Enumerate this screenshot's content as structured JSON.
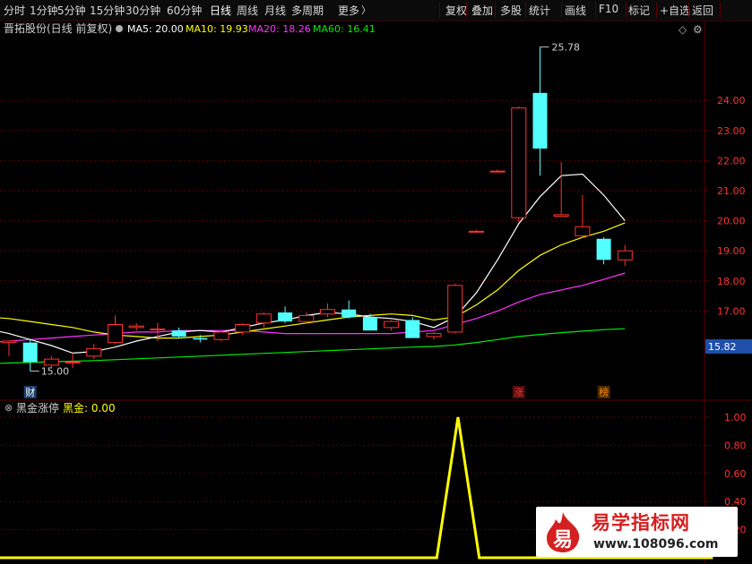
{
  "toolbar": {
    "periods": [
      "分时",
      "1分钟",
      "5分钟",
      "15分钟",
      "30分钟",
      "60分钟",
      "日线",
      "周线",
      "月线",
      "多周期"
    ],
    "active": "日线",
    "more": "更多",
    "more_arrow": "〉",
    "actions": [
      "复权",
      "叠加",
      "多股",
      "统计",
      "画线",
      "F10",
      "标记",
      "+自选",
      "返回"
    ]
  },
  "main_panel": {
    "title": "晋拓股份(日线 前复权)",
    "ma_legend": [
      {
        "label": "MA5: 20.00",
        "color": "#ffffff"
      },
      {
        "label": "MA10: 19.93",
        "color": "#ffff00"
      },
      {
        "label": "MA20: 18.26",
        "color": "#ff33ff"
      },
      {
        "label": "MA60: 16.41",
        "color": "#00ee00"
      }
    ],
    "high_label": "25.78",
    "low_label": "15.00",
    "price_tag": "15.82",
    "markers": [
      {
        "text": "财",
        "index": 1,
        "color": "#ffffff",
        "bg": "#1c3f6e"
      },
      {
        "text": "涨",
        "index": 24,
        "color": "#ff3333",
        "bg": "#4a0e0e"
      },
      {
        "text": "榜",
        "index": 28,
        "color": "#ff8800",
        "bg": "#4a2a00"
      }
    ],
    "icons": [
      "diamond-icon",
      "gear-icon"
    ]
  },
  "indicator_panel": {
    "title": "黑金涨停",
    "series_label": "黑金: 0.00"
  },
  "watermark": {
    "logo_char": "易",
    "title": "易学指标网",
    "url": "www.108096.com"
  },
  "colors": {
    "up": "#ff3232",
    "down": "#54ffff",
    "grid": "#5a0000",
    "axis_text": "#ff3232",
    "ma5": "#ffffff",
    "ma10": "#ffff00",
    "ma20": "#ff33ff",
    "ma60": "#00ee00",
    "indicator": "#ffff00"
  },
  "chart_data": [
    {
      "type": "candlestick",
      "ylim": [
        14.6,
        26.0
      ],
      "yticks": [
        17.0,
        18.0,
        19.0,
        20.0,
        21.0,
        22.0,
        23.0,
        24.0
      ],
      "candles": [
        {
          "o": 15.95,
          "h": 16.0,
          "l": 15.5,
          "c": 16.0
        },
        {
          "o": 15.95,
          "h": 16.05,
          "l": 15.0,
          "c": 15.3
        },
        {
          "o": 15.2,
          "h": 15.5,
          "l": 15.1,
          "c": 15.4
        },
        {
          "o": 15.3,
          "h": 15.6,
          "l": 15.1,
          "c": 15.3
        },
        {
          "o": 15.5,
          "h": 15.9,
          "l": 15.4,
          "c": 15.75
        },
        {
          "o": 15.95,
          "h": 16.85,
          "l": 15.9,
          "c": 16.55
        },
        {
          "o": 16.45,
          "h": 16.6,
          "l": 16.35,
          "c": 16.5
        },
        {
          "o": 16.4,
          "h": 16.6,
          "l": 16.0,
          "c": 16.4
        },
        {
          "o": 16.35,
          "h": 16.45,
          "l": 16.1,
          "c": 16.15
        },
        {
          "o": 16.1,
          "h": 16.2,
          "l": 15.95,
          "c": 16.05
        },
        {
          "o": 16.05,
          "h": 16.3,
          "l": 16.0,
          "c": 16.3
        },
        {
          "o": 16.3,
          "h": 16.6,
          "l": 16.2,
          "c": 16.55
        },
        {
          "o": 16.6,
          "h": 16.95,
          "l": 16.45,
          "c": 16.9
        },
        {
          "o": 16.95,
          "h": 17.15,
          "l": 16.6,
          "c": 16.65
        },
        {
          "o": 16.65,
          "h": 16.95,
          "l": 16.6,
          "c": 16.85
        },
        {
          "o": 16.9,
          "h": 17.25,
          "l": 16.8,
          "c": 17.05
        },
        {
          "o": 17.05,
          "h": 17.35,
          "l": 16.75,
          "c": 16.8
        },
        {
          "o": 16.8,
          "h": 16.9,
          "l": 16.4,
          "c": 16.35
        },
        {
          "o": 16.45,
          "h": 16.7,
          "l": 16.35,
          "c": 16.65
        },
        {
          "o": 16.7,
          "h": 16.8,
          "l": 16.1,
          "c": 16.1
        },
        {
          "o": 16.15,
          "h": 16.3,
          "l": 16.05,
          "c": 16.25
        },
        {
          "o": 16.3,
          "h": 17.9,
          "l": 16.25,
          "c": 17.85
        },
        {
          "o": 19.65,
          "h": 19.7,
          "l": 19.6,
          "c": 19.65
        },
        {
          "o": 21.65,
          "h": 21.7,
          "l": 21.6,
          "c": 21.65
        },
        {
          "o": 20.1,
          "h": 23.8,
          "l": 19.95,
          "c": 23.75
        },
        {
          "o": 24.25,
          "h": 25.78,
          "l": 21.5,
          "c": 22.4
        },
        {
          "o": 20.15,
          "h": 21.95,
          "l": 20.15,
          "c": 20.2
        },
        {
          "o": 19.5,
          "h": 20.85,
          "l": 19.5,
          "c": 19.8
        },
        {
          "o": 19.4,
          "h": 19.45,
          "l": 18.55,
          "c": 18.7
        },
        {
          "o": 18.7,
          "h": 19.2,
          "l": 18.5,
          "c": 19.0
        }
      ],
      "ma5": [
        16.4,
        16.25,
        16.05,
        15.85,
        15.6,
        15.65,
        15.8,
        16.0,
        16.15,
        16.3,
        16.35,
        16.3,
        16.45,
        16.6,
        16.7,
        16.85,
        16.95,
        16.9,
        16.8,
        16.75,
        16.65,
        16.45,
        16.8,
        17.6,
        18.7,
        19.9,
        20.8,
        21.5,
        21.55,
        20.85,
        20.0
      ],
      "ma10": [
        16.8,
        16.75,
        16.65,
        16.55,
        16.45,
        16.3,
        16.2,
        16.15,
        16.1,
        16.1,
        16.15,
        16.2,
        16.3,
        16.4,
        16.5,
        16.6,
        16.7,
        16.8,
        16.85,
        16.9,
        16.85,
        16.7,
        16.8,
        17.2,
        17.7,
        18.35,
        18.85,
        19.2,
        19.45,
        19.65,
        19.93
      ],
      "ma20": [
        15.95,
        16.0,
        16.05,
        16.1,
        16.15,
        16.2,
        16.25,
        16.3,
        16.3,
        16.35,
        16.35,
        16.35,
        16.35,
        16.3,
        16.25,
        16.25,
        16.25,
        16.25,
        16.25,
        16.25,
        16.3,
        16.35,
        16.55,
        16.75,
        17.0,
        17.3,
        17.55,
        17.7,
        17.85,
        18.05,
        18.26
      ],
      "ma60": [
        15.25,
        15.27,
        15.29,
        15.31,
        15.33,
        15.35,
        15.38,
        15.41,
        15.44,
        15.47,
        15.5,
        15.53,
        15.56,
        15.59,
        15.62,
        15.65,
        15.68,
        15.71,
        15.74,
        15.77,
        15.8,
        15.82,
        15.87,
        15.95,
        16.05,
        16.15,
        16.22,
        16.28,
        16.33,
        16.38,
        16.41
      ]
    },
    {
      "type": "line",
      "name": "黑金",
      "ylim": [
        0,
        1.0
      ],
      "yticks": [
        0.2,
        0.4,
        0.6,
        0.8,
        1.0
      ],
      "values": [
        0,
        0,
        0,
        0,
        0,
        0,
        0,
        0,
        0,
        0,
        0,
        0,
        0,
        0,
        0,
        0,
        0,
        0,
        0,
        0,
        0,
        0,
        1,
        0,
        0,
        0,
        0,
        0,
        0,
        0,
        0,
        0,
        0,
        0,
        0
      ]
    }
  ]
}
